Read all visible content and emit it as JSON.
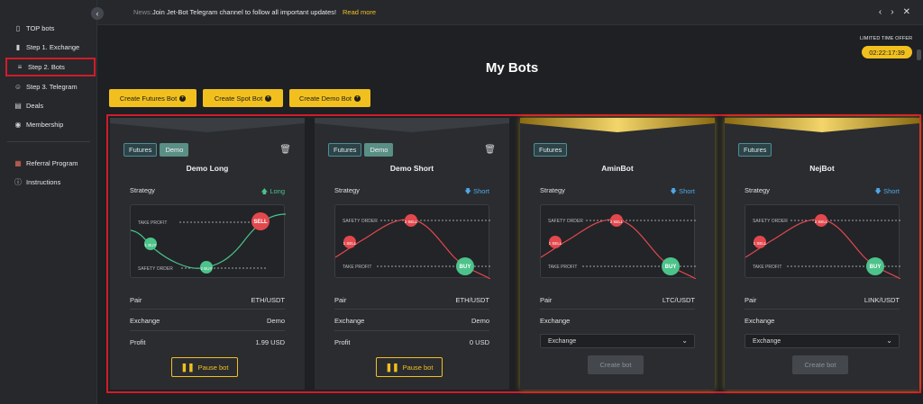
{
  "sidebar": {
    "items": [
      {
        "label": "TOP bots",
        "icon": "mobile-icon",
        "glyph": "▯"
      },
      {
        "label": "Step 1. Exchange",
        "icon": "bar-chart-icon",
        "glyph": "▮"
      },
      {
        "label": "Step 2. Bots",
        "icon": "sliders-icon",
        "glyph": "≡"
      },
      {
        "label": "Step 3. Telegram",
        "icon": "user-icon",
        "glyph": "☺"
      },
      {
        "label": "Deals",
        "icon": "document-icon",
        "glyph": "▤"
      },
      {
        "label": "Membership",
        "icon": "database-icon",
        "glyph": "◉"
      },
      {
        "label": "Referral Program",
        "icon": "colorful-grid-icon",
        "glyph": "▦"
      },
      {
        "label": "Instructions",
        "icon": "info-icon",
        "glyph": "ⓘ"
      }
    ]
  },
  "topbar": {
    "news_label": "News:",
    "news_text": "Join Jet-Bot Telegram channel to follow all important updates!",
    "news_link": "Read more"
  },
  "offer": {
    "label": "LIMITED TIME OFFER",
    "timer": "02:22:17:39"
  },
  "page": {
    "title": "My Bots"
  },
  "create_buttons": [
    {
      "label": "Create Futures Bot"
    },
    {
      "label": "Create Spot Bot"
    },
    {
      "label": "Create Demo Bot"
    }
  ],
  "labels": {
    "strategy": "Strategy",
    "pair": "Pair",
    "exchange": "Exchange",
    "profit": "Profit",
    "pause_bot": "Pause bot",
    "create_bot": "Create bot",
    "exchange_placeholder": "Exchange"
  },
  "bots": [
    {
      "name": "Demo Long",
      "tags": [
        "Futures",
        "Demo"
      ],
      "direction": "Long",
      "pair": "ETH/USDT",
      "exchange": "Demo",
      "profit": "1.99 USD",
      "chart": {
        "top_line": "TAKE PROFIT",
        "bottom_line": "SAFETY ORDER",
        "markers": [
          "1 BUY",
          "2 BUY",
          "SELL"
        ]
      }
    },
    {
      "name": "Demo Short",
      "tags": [
        "Futures",
        "Demo"
      ],
      "direction": "Short",
      "pair": "ETH/USDT",
      "exchange": "Demo",
      "profit": "0 USD",
      "chart": {
        "top_line": "SAFETY ORDER",
        "bottom_line": "TAKE PROFIT",
        "markers": [
          "1 SELL",
          "2 SELL",
          "BUY"
        ]
      }
    },
    {
      "name": "AminBot",
      "tags": [
        "Futures"
      ],
      "direction": "Short",
      "pair": "LTC/USDT",
      "exchange_select": "Exchange",
      "chart": {
        "top_line": "SAFETY ORDER",
        "bottom_line": "TAKE PROFIT",
        "markers": [
          "1 SELL",
          "2 SELL",
          "BUY"
        ]
      }
    },
    {
      "name": "NejBot",
      "tags": [
        "Futures"
      ],
      "direction": "Short",
      "pair": "LINK/USDT",
      "exchange_select": "Exchange",
      "chart": {
        "top_line": "SAFETY ORDER",
        "bottom_line": "TAKE PROFIT",
        "markers": [
          "1 SELL",
          "2 SELL",
          "BUY"
        ]
      }
    }
  ],
  "colors": {
    "accent": "#f2c01e",
    "highlight": "#d01c2a",
    "long": "#4cc38a",
    "short": "#4fa8e8",
    "sell_marker": "#e2484d",
    "buy_marker": "#4cc38a"
  }
}
